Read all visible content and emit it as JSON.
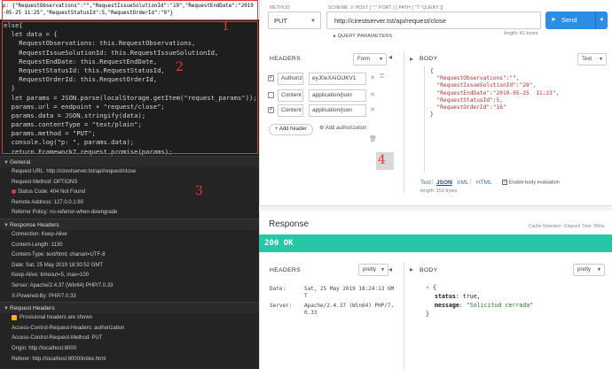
{
  "console_output": "p: {\"RequestObservations\":\"\",\"RequestIssueSolutionId\":\"19\",\"RequestEndDate\":\"2019-05-25 11:25\",\"RequestStatusId\":5,\"RequestOrderId\":\"9\"}",
  "code_lines": [
    "else{",
    "  let data = {",
    "    RequestObservations: this.RequestObservations,",
    "    RequestIssueSolutionId: this.RequestIssueSolutionId,",
    "    RequestEndDate: this.RequestEndDate,",
    "    RequestStatusId: this.RequestStatusId,",
    "    RequestOrderId: this.RequestOrderId,",
    "  }",
    "  let params = JSON.parse(localStorage.getItem(\"request_params\"));",
    "  params.url = endpoint + \"request/close\";",
    "  params.data = JSON.stringify(data);",
    "  params.contentType = \"text/plain\";",
    "  params.method = \"PUT\";",
    "  console.log(\"p: \", params.data);",
    "  return Framework7.request.promise(params);",
    "}"
  ],
  "annotations": [
    "1",
    "2",
    "3",
    "4"
  ],
  "devtools": {
    "general": {
      "title": "General",
      "rows": [
        "Request URL: http://cirestserver.tst/api/request/close",
        "Request Method: OPTIONS",
        "Status Code: 404 Not Found",
        "Remote Address: 127.0.0.1:80",
        "Referrer Policy: no-referrer-when-downgrade"
      ]
    },
    "response_headers": {
      "title": "Response Headers",
      "rows": [
        "Connection: Keep-Alive",
        "Content-Length: 1130",
        "Content-Type: text/html; charset=UTF-8",
        "Date: Sat, 25 May 2019 18:30:52 GMT",
        "Keep-Alive: timeout=5, max=100",
        "Server: Apache/2.4.37 (Win64) PHP/7.0.33",
        "X-Powered-By: PHP/7.0.33"
      ]
    },
    "request_headers": {
      "title": "Request Headers",
      "rows": [
        "Provisional headers are shown",
        "Access-Control-Request-Headers: authorization",
        "Access-Control-Request-Method: PUT",
        "Origin: http://localhost:8000",
        "Referer: http://localhost:8000/index.html"
      ]
    }
  },
  "rest": {
    "method_label": "METHOD",
    "method_value": "PUT",
    "scheme_label": "SCHEME :// HOST [ \":\" PORT ] [ PATH [ \"?\" QUERY ]]",
    "url": "http://cirestserver.tst/api/request/close",
    "url_length": "length: 41 bytes",
    "send_label": "Send",
    "query_params": "QUERY PARAMETERS",
    "headers_label": "HEADERS",
    "headers_format": "Form",
    "body_label": "BODY",
    "body_format": "Text",
    "header_rows": [
      {
        "key": "Authoriz",
        "value": "eyJ0eXAiOiJKV1"
      },
      {
        "key": "Content",
        "value": "application/json"
      },
      {
        "key": "Content",
        "value": "application/json"
      }
    ],
    "add_header": "+ Add header",
    "add_auth": "Add authorization",
    "body_lines": [
      "{",
      "  \"RequestObservations\":\"\",",
      "  \"RequestIssueSolutionId\":\"28\",",
      "  \"RequestEndDate\":\"2019-05-25  11:23\",",
      "  \"RequestStatusId\":5,",
      "  \"RequestOrderId\":\"16\"",
      "}"
    ],
    "body_tabs": [
      "Text",
      "JSON",
      "XML",
      "HTML"
    ],
    "body_eval_label": "Enable body evaluation",
    "body_length": "length: 153 bytes"
  },
  "response": {
    "title": "Response",
    "cache_note": "Cache Detected - Elapsed Time: 89ms",
    "status": "200 OK",
    "headers_label": "HEADERS",
    "headers_format": "pretty",
    "body_label": "BODY",
    "body_format": "pretty",
    "header_rows": [
      {
        "key": "Date:",
        "value": "Sat, 25 May 2019 18:24:13 GM"
      },
      {
        "key": "",
        "value": "T"
      },
      {
        "key": "Server:",
        "value": "Apache/2.4.37 (Win64) PHP/7."
      },
      {
        "key": "",
        "value": "0.33"
      }
    ],
    "json_status_key": "status",
    "json_status_val": "true,",
    "json_message_key": "message",
    "json_message_val": "\"Solicitud cerrada\""
  },
  "colors": {
    "accent": "#2d8de5",
    "status_ok": "#26c6a6",
    "annotation": "#e53935"
  }
}
